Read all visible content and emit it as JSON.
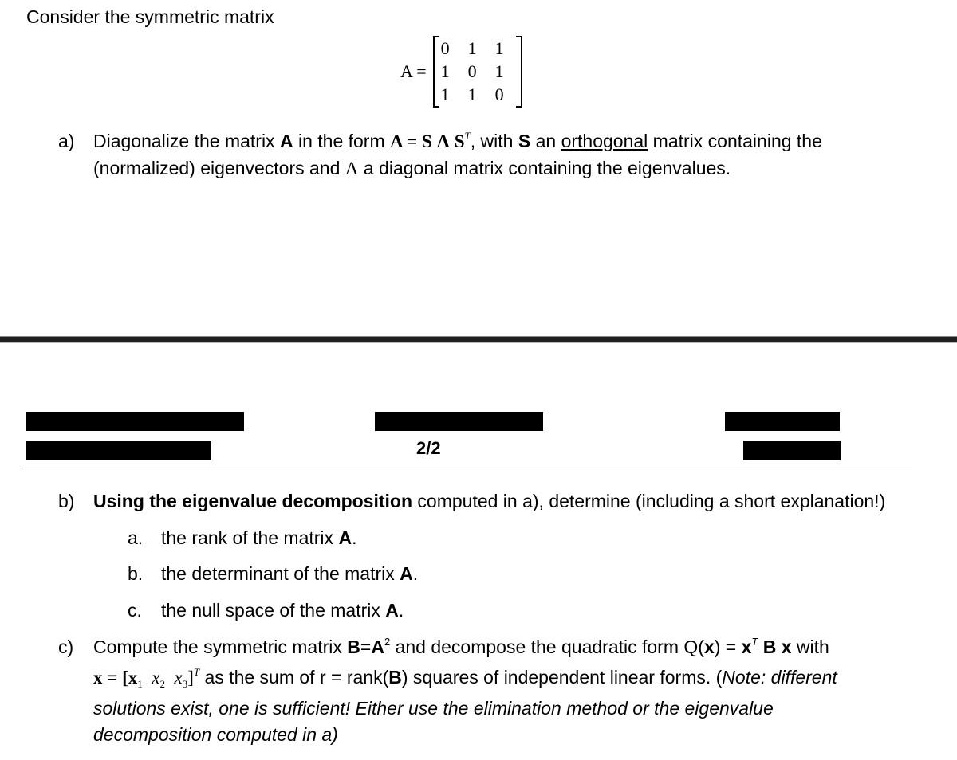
{
  "intro": "Consider the symmetric matrix",
  "matrix": {
    "name": "A",
    "equals": "=",
    "rows": [
      [
        "0",
        "1",
        "1"
      ],
      [
        "1",
        "0",
        "1"
      ],
      [
        "1",
        "1",
        "0"
      ]
    ]
  },
  "part_a": {
    "label": "a)",
    "line1_pre": "Diagonalize the matrix ",
    "line1_A": "A",
    "line1_mid": " in the form ",
    "formula": "A = S Λ S",
    "formula_sup": "T",
    "line1_post1": ", with ",
    "line1_S": "S",
    "line1_post2": " an ",
    "underlined": "orthogonal",
    "line1_post3": " matrix containing the",
    "line2_pre": "(normalized) eigenvectors and ",
    "line2_lambda": "Λ",
    "line2_post": " a diagonal matrix containing the eigenvalues."
  },
  "page_footer": {
    "page_number": "2/2"
  },
  "part_b": {
    "label": "b)",
    "bold": "Using the eigenvalue decomposition",
    "rest": " computed in a), determine (including a short explanation!)",
    "items": [
      {
        "label": "a.",
        "text": "the rank of the matrix ",
        "bold": "A",
        "end": "."
      },
      {
        "label": "b.",
        "text": "the determinant of the matrix ",
        "bold": "A",
        "end": "."
      },
      {
        "label": "c.",
        "text": "the null space of the matrix ",
        "bold": "A",
        "end": "."
      }
    ]
  },
  "part_c": {
    "label": "c)",
    "l1_pre": "Compute the symmetric matrix ",
    "l1_B": "B",
    "l1_eq": "=",
    "l1_A": "A",
    "l1_sup": "2",
    "l1_mid": " and decompose the quadratic form Q(",
    "l1_x": "x",
    "l1_mid2": ") = ",
    "l1_xT": "x",
    "l1_T": "T",
    "l1_Bx": " B x",
    "l1_end": " with",
    "l2_vec": "x = [x",
    "l2_x1": "1",
    "l2_x2": "x",
    "l2_x2s": "2",
    "l2_x3": "x",
    "l2_x3s": "3",
    "l2_close": "]",
    "l2_T": "T",
    "l2_text": " as the sum of r = rank(",
    "l2_B": "B",
    "l2_text2": ") squares of independent linear forms. (",
    "l2_note": "Note: different",
    "l3": "solutions exist, one is sufficient! Either use the elimination method or the eigenvalue",
    "l4": "decomposition computed in a)"
  }
}
